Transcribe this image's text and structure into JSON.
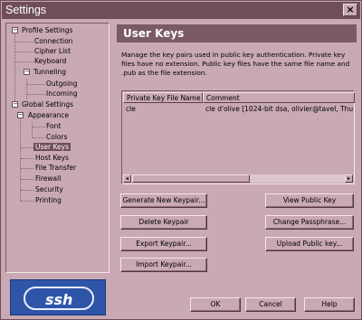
{
  "window": {
    "title": "Settings",
    "close_glyph": "×"
  },
  "tree": {
    "profile_settings": "Profile Settings",
    "connection": "Connection",
    "cipher_list": "Cipher List",
    "keyboard": "Keyboard",
    "tunneling": "Tunneling",
    "outgoing": "Outgoing",
    "incoming": "Incoming",
    "global_settings": "Global Settings",
    "appearance": "Appearance",
    "font": "Font",
    "colors": "Colors",
    "user_keys": "User Keys",
    "host_keys": "Host Keys",
    "file_transfer": "File Transfer",
    "firewall": "Firewall",
    "security": "Security",
    "printing": "Printing",
    "expanded_glyph": "−"
  },
  "logo": {
    "text": "ssh"
  },
  "panel": {
    "title": "User Keys",
    "description": "Manage the key pairs used in public key authentication. Private key files have no extension. Public key files have the same file name and .pub as the file extension."
  },
  "keys_table": {
    "columns": [
      "Private Key File Name",
      "Comment"
    ],
    "rows": [
      {
        "file": "cle",
        "comment": "cle d'olive [1024-bit dsa, olivier@tavel, Thu Aug"
      }
    ]
  },
  "scrollbar": {
    "left_arrow": "◂",
    "right_arrow": "▸"
  },
  "buttons": {
    "generate": "Generate New Keypair...",
    "delete": "Delete Keypair",
    "export": "Export Keypair...",
    "import": "Import Keypair...",
    "view_public": "View Public Key",
    "change_pass": "Change Passphrase...",
    "upload_public": "Upload Public key...",
    "ok": "OK",
    "cancel": "Cancel",
    "help": "Help"
  }
}
